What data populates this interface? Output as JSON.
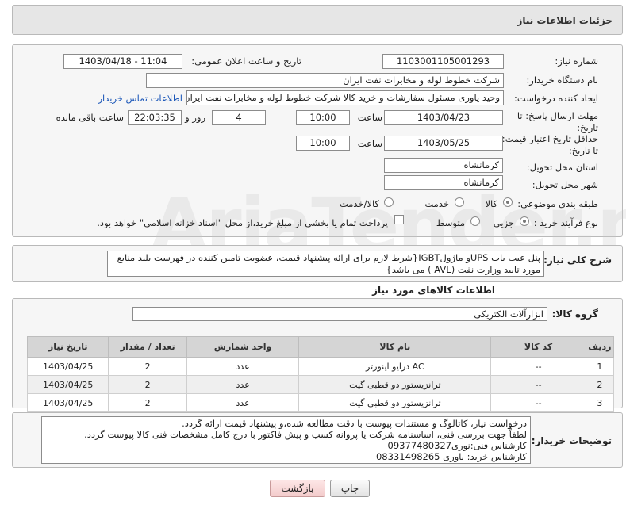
{
  "header": {
    "title": "جزئیات اطلاعات نیاز"
  },
  "form": {
    "need_number_label": "شماره نیاز:",
    "need_number": "1103001105001293",
    "announce_label": "تاریخ و ساعت اعلان عمومی:",
    "announce_value": "1403/04/18 - 11:04",
    "buyer_org_label": "نام دستگاه خریدار:",
    "buyer_org": "شرکت خطوط لوله و مخابرات نفت ایران",
    "requester_label": "ایجاد کننده درخواست:",
    "requester": "وحید یاوری مسئول سفارشات و خرید کالا  شرکت خطوط لوله و مخابرات نفت ایران",
    "contact_link": "اطلاعات تماس خریدار",
    "reply_deadline_label": "مهلت ارسال پاسخ: تا تاریخ:",
    "reply_date": "1403/04/23",
    "time_label": "ساعت",
    "reply_time": "10:00",
    "days_value": "4",
    "days_label": "روز و",
    "remaining_time": "22:03:35",
    "remaining_label": "ساعت باقی مانده",
    "validity_label": "حداقل تاریخ اعتبار قیمت: تا تاریخ:",
    "validity_date": "1403/05/25",
    "validity_time": "10:00",
    "province_label": "استان محل تحویل:",
    "province": "کرمانشاه",
    "city_label": "شهر محل تحویل:",
    "city": "کرمانشاه",
    "category_label": "طبقه بندی موضوعی:",
    "category_options": [
      "کالا",
      "خدمت",
      "کالا/خدمت"
    ],
    "process_label": "نوع فرآیند خرید :",
    "process_options": [
      "جزیی",
      "متوسط"
    ],
    "payment_note": "پرداخت تمام یا بخشی از مبلغ خرید،از محل \"اسناد خزانه اسلامی\" خواهد بود."
  },
  "description": {
    "label": "شرح کلی نیاز:",
    "line1": "پنل عیب یاب UPSو ماژولIGBT{شرط لازم برای ارائه پیشنهاد قیمت، عضویت تامین کننده در فهرست بلند منابع",
    "line2": "مورد تایید وزارت نفت (AVL ) می باشد}"
  },
  "goods": {
    "section_title": "اطلاعات کالاهای مورد نیاز",
    "group_label": "گروه کالا:",
    "group_value": "ابزارآلات الکتریکی",
    "columns": [
      "ردیف",
      "کد کالا",
      "نام کالا",
      "واحد شمارش",
      "تعداد / مقدار",
      "تاریخ نیاز"
    ],
    "rows": [
      {
        "index": "1",
        "code": "--",
        "name": "درایو اینورتر AC",
        "unit": "عدد",
        "qty": "2",
        "date": "1403/04/25"
      },
      {
        "index": "2",
        "code": "--",
        "name": "ترانزیستور دو قطبی گیت",
        "unit": "عدد",
        "qty": "2",
        "date": "1403/04/25"
      },
      {
        "index": "3",
        "code": "--",
        "name": "ترانزیستور دو قطبی گیت",
        "unit": "عدد",
        "qty": "2",
        "date": "1403/04/25"
      }
    ]
  },
  "buyer_notes": {
    "label": "توضیحات خریدار:",
    "lines": [
      "درخواست نیاز، کاتالوگ و مستندات پیوست با دقت مطالعه شده،و پیشنهاد قیمت ارائه گردد.",
      "لطفاً جهت بررسی فنی، اساسنامه شرکت یا پروانه کسب و پیش فاکتور با درج کامل مشخصات فنی کالا پیوست گردد.",
      "کارشناس فنی:نوری09377480327",
      "کارشناس خرید: یاوری 08331498265"
    ]
  },
  "buttons": {
    "print": "چاپ",
    "back": "بازگشت"
  },
  "watermark": "AriaTender.net",
  "colors": {
    "link": "#1a56b8",
    "back_button_bg": "#f7d6d6"
  }
}
